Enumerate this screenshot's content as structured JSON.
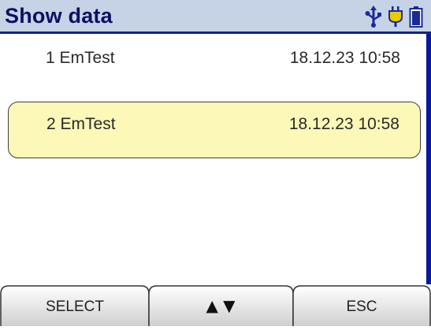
{
  "header": {
    "title": "Show data"
  },
  "status_icons": [
    {
      "name": "usb-icon",
      "color": "#1b2a99"
    },
    {
      "name": "plug-icon",
      "color": "#e9cc00"
    },
    {
      "name": "battery-icon",
      "color": "#1b2a99"
    }
  ],
  "list": {
    "items": [
      {
        "label": "1 EmTest",
        "date": "18.12.23 10:58",
        "selected": false
      },
      {
        "label": "2 EmTest",
        "date": "18.12.23 10:58",
        "selected": true
      }
    ]
  },
  "softkeys": {
    "select": "SELECT",
    "nav": "▲ ▼",
    "esc": "ESC"
  },
  "colors": {
    "title_bar": "#c6d3e6",
    "accent": "#16218a",
    "highlight": "#fbf8b8"
  }
}
